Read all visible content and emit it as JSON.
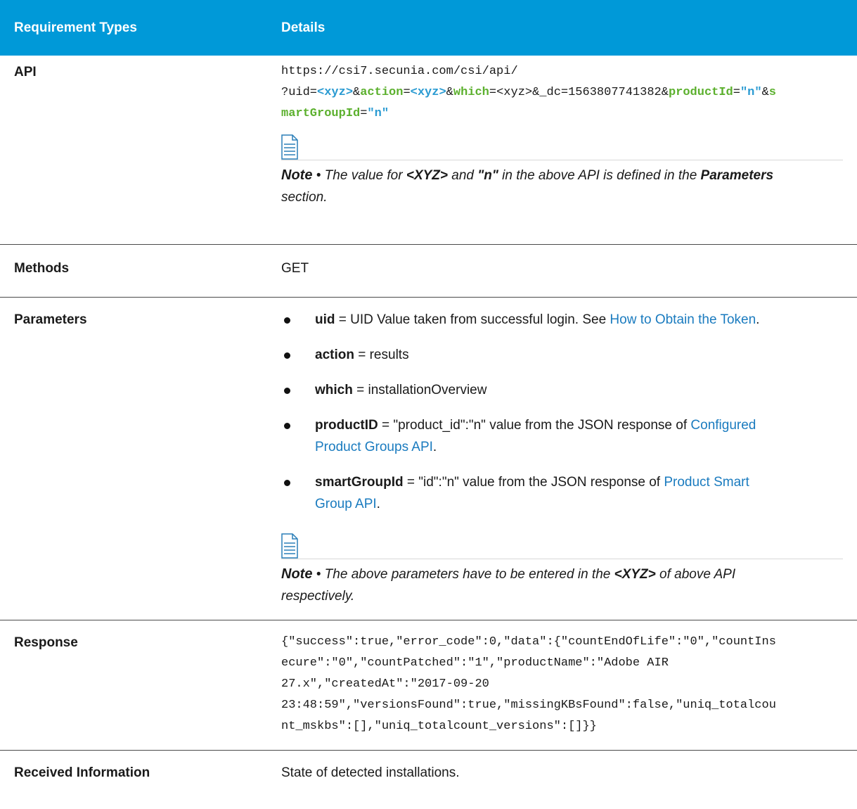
{
  "header": {
    "col1": "Requirement Types",
    "col2": "Details"
  },
  "api": {
    "label": "API",
    "line1": "https://csi7.secunia.com/csi/api/",
    "seg": {
      "s1": "?uid=",
      "s2": "<xyz>",
      "s3": "&",
      "s4": "action",
      "s5": "=",
      "s6": "<xyz>",
      "s7": "&",
      "s8": "which",
      "s9": "=<xyz>&_dc=1563807741382&",
      "s10": "productId",
      "s11": "=",
      "s12": "\"n\"",
      "s13": "&",
      "s14": "s",
      "s15": "martGroupId",
      "s16": "=",
      "s17": "\"n\""
    },
    "note": {
      "prefix": "Note",
      "bullet": " • ",
      "t1": "The value for ",
      "b1": "<XYZ>",
      "t2": " and ",
      "b2": "\"n\"",
      "t3": " in the above API is defined in the ",
      "b3": "Parameters",
      "t4": "section."
    }
  },
  "methods": {
    "label": "Methods",
    "value": "GET"
  },
  "parameters": {
    "label": "Parameters",
    "items": [
      {
        "key": "uid",
        "text": " = UID Value taken from successful login. See ",
        "link": "How to Obtain the Token",
        "after": "."
      },
      {
        "key": "action",
        "text": " = results"
      },
      {
        "key": "which",
        "text": " = installationOverview"
      },
      {
        "key": "productID",
        "text": " = \"product_id\":\"n\" value from the JSON response of ",
        "link_a": "Configured",
        "link_b": "Product Groups API",
        "after": "."
      },
      {
        "key": "smartGroupId",
        "text": " = \"id\":\"n\" value from the JSON response of ",
        "link_a": "Product Smart",
        "link_b": "Group API",
        "after": "."
      }
    ],
    "note": {
      "prefix": "Note",
      "bullet": " • ",
      "t1": "The above parameters have to be entered in the ",
      "b1": "<XYZ>",
      "t2": " of above API",
      "t3": "respectively."
    }
  },
  "response": {
    "label": "Response",
    "lines": [
      "{\"success\":true,\"error_code\":0,\"data\":{\"countEndOfLife\":\"0\",\"countIns",
      "ecure\":\"0\",\"countPatched\":\"1\",\"productName\":\"Adobe AIR",
      "27.x\",\"createdAt\":\"2017-09-20",
      "23:48:59\",\"versionsFound\":true,\"missingKBsFound\":false,\"uniq_totalcou",
      "nt_mskbs\":[],\"uniq_totalcount_versions\":[]}}"
    ]
  },
  "received": {
    "label": "Received Information",
    "value": "State of detected installations."
  },
  "icons": {
    "note": "note-document-icon"
  },
  "colors": {
    "header_bg": "#0099d8",
    "green": "#5cb02e",
    "blue": "#2b9bd2",
    "link": "#1a7bbf"
  }
}
